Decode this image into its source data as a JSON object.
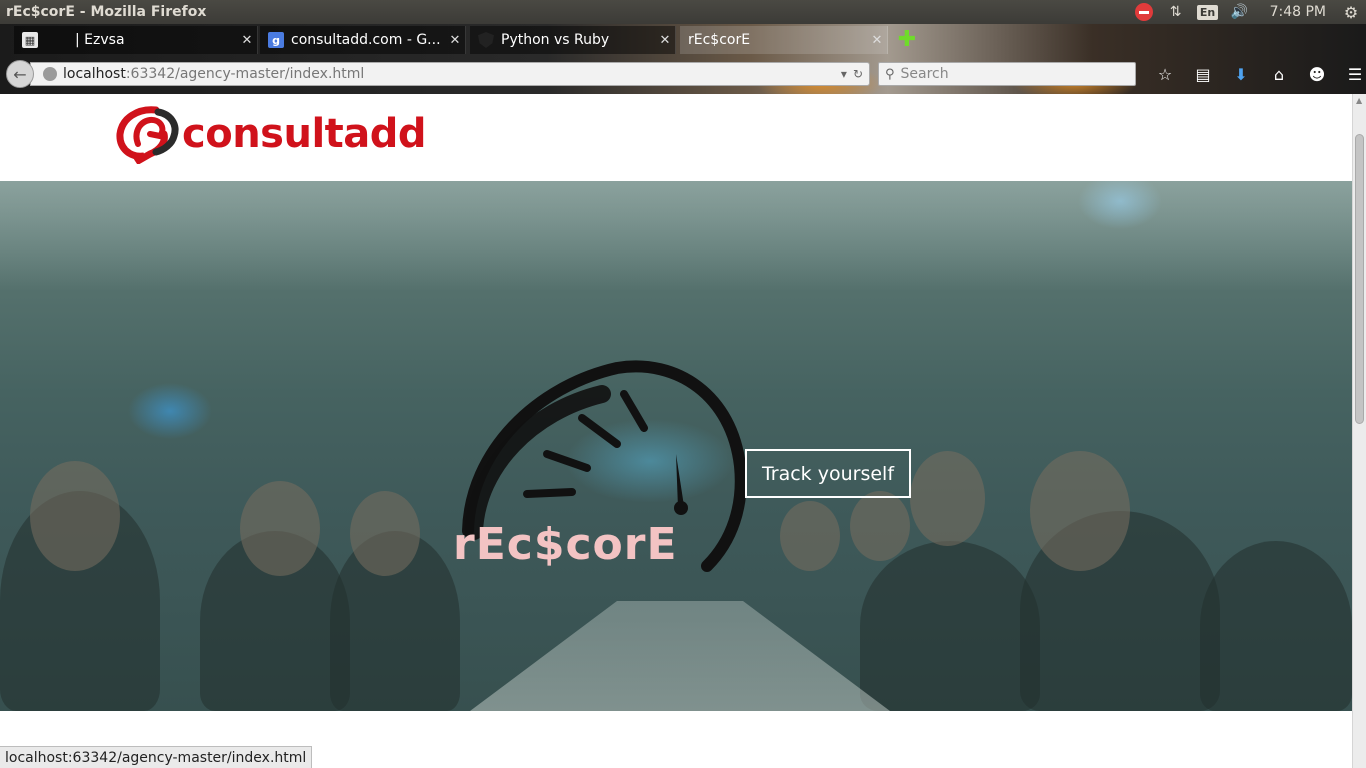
{
  "os": {
    "window_title": "rEc$corE - Mozilla Firefox",
    "keyboard_layout": "En",
    "clock": "7:48 PM",
    "icons": [
      "stop-icon",
      "network-arrows-icon",
      "volume-icon",
      "gear-icon"
    ]
  },
  "browser": {
    "tabs": [
      {
        "title": "| Ezvsa",
        "favicon": "calendar-icon",
        "active": false
      },
      {
        "title": "consultadd.com - G...",
        "favicon": "google-icon",
        "active": false
      },
      {
        "title": "Python vs Ruby",
        "favicon": "shield-icon",
        "active": false
      },
      {
        "title": "rEc$corE",
        "favicon": "",
        "active": true
      }
    ],
    "url_host": "localhost",
    "url_path": ":63342/agency-master/index.html",
    "search_placeholder": "Search",
    "status_url": "localhost:63342/agency-master/index.html"
  },
  "page": {
    "logo_text": "consultadd",
    "brand_text": "rEc$corE",
    "cta_label": "Track yourself"
  },
  "colors": {
    "logo_red": "#d0121b",
    "brand_pink": "#f3c3c3"
  }
}
